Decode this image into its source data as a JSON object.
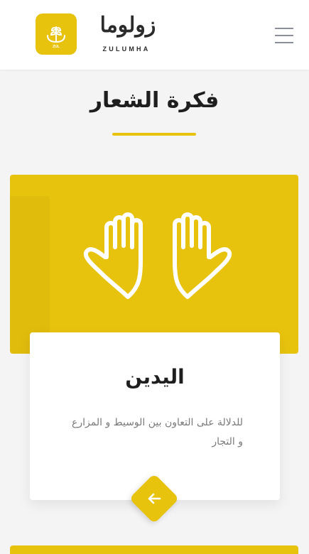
{
  "header": {
    "logo_ar": "زولوما",
    "logo_en": "ZULUMHA",
    "logo_icon": "wheat-hands-logo-icon",
    "menu_icon": "hamburger-menu-icon"
  },
  "section": {
    "title": "فكرة الشعار"
  },
  "card": {
    "icon": "raised-hands-icon",
    "title": "اليدين",
    "text": "للدلالة على التعاون بين الوسيط و المزارع و التجار",
    "nav_icon": "arrow-left-icon"
  },
  "colors": {
    "accent": "#e8c30e",
    "heading": "#1e1e1e",
    "body_text": "#7a7a7a",
    "background": "#f4f4f4"
  }
}
